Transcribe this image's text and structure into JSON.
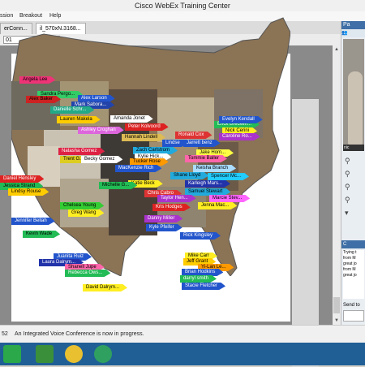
{
  "window": {
    "title": "Cisco WebEx Training Center"
  },
  "menu": [
    {
      "label": "ssion"
    },
    {
      "label": "Breakout"
    },
    {
      "label": "Help"
    }
  ],
  "tabs": [
    {
      "label": "erConn..."
    },
    {
      "label": "il_570xN.3168..."
    }
  ],
  "toolbar": {
    "page_value": "01"
  },
  "panel": {
    "header": "Pa",
    "video_name": "nic",
    "chat_header": "C",
    "chat_text": "Trying t from M great jo from M great jo",
    "send_to_label": "Send to"
  },
  "status": {
    "left_number": "52",
    "message": "An Integrated Voice Conference is now in progress."
  },
  "colors": {
    "taskbar": "#1f5f95",
    "panel_header": "#3f6fa6"
  },
  "labels": [
    {
      "text": "Angela Lee",
      "color": "#ee3377"
    },
    {
      "text": "Sandra Pergo...",
      "color": "#33cc66"
    },
    {
      "text": "Alex Baker",
      "color": "#cc2222"
    },
    {
      "text": "Alex Larson",
      "color": "#2255cc"
    },
    {
      "text": "Mark Sabora...",
      "color": "#2244aa"
    },
    {
      "text": "Danielle Schr...",
      "color": "#22aa88"
    },
    {
      "text": "Amanda Jonet",
      "color": "#ffffff"
    },
    {
      "text": "Lauren Makela",
      "color": "#ffcc00"
    },
    {
      "text": "Ashley Croghan",
      "color": "#dd66dd"
    },
    {
      "text": "Peter Kolvoord",
      "color": "#dd2222"
    },
    {
      "text": "Erick Brecken...",
      "color": "#22bb55"
    },
    {
      "text": "Evelyn Kendall",
      "color": "#2255cc"
    },
    {
      "text": "Nick Cerini",
      "color": "#ffee22"
    },
    {
      "text": "Ronald Cox",
      "color": "#dd3333"
    },
    {
      "text": "Hannah Lindell",
      "color": "#ddbb55"
    },
    {
      "text": "Caroline Ro...",
      "color": "#aa33cc"
    },
    {
      "text": "Lindse",
      "color": "#2255cc"
    },
    {
      "text": "Jarrett benz",
      "color": "#2255cc"
    },
    {
      "text": "Natasha Gomez",
      "color": "#dd2244"
    },
    {
      "text": "Zach Carlstrom",
      "color": "#22aadd"
    },
    {
      "text": "Trent G...",
      "color": "#ddcc22"
    },
    {
      "text": "Kylie Hick...",
      "color": "#ffffff"
    },
    {
      "text": "Jake Hom...",
      "color": "#ffff44"
    },
    {
      "text": "Becky Gomez",
      "color": "#ffffff"
    },
    {
      "text": "Tucker Rose",
      "color": "#ff9900"
    },
    {
      "text": "Tommie Baller",
      "color": "#ff66aa"
    },
    {
      "text": "MacKenzie Rich",
      "color": "#2255cc"
    },
    {
      "text": "Keisha Branch",
      "color": "#aaddff"
    },
    {
      "text": "Shane Lloyd",
      "color": "#22aadd"
    },
    {
      "text": "Spencer Mc...",
      "color": "#22ccff"
    },
    {
      "text": "Katie Beck",
      "color": "#ffee22"
    },
    {
      "text": "Karleigh Mars...",
      "color": "#2233aa"
    },
    {
      "text": "Michelle G...",
      "color": "#22bb55"
    },
    {
      "text": "Chris Cabro",
      "color": "#dd3333"
    },
    {
      "text": "Samuel Stewart",
      "color": "#22aadd"
    },
    {
      "text": "Taylor Hen...",
      "color": "#aa33cc"
    },
    {
      "text": "Marcie Stev...",
      "color": "#ff66ff"
    },
    {
      "text": "Kris Hodges",
      "color": "#dd2222"
    },
    {
      "text": "Jenna Mac...",
      "color": "#ffee22"
    },
    {
      "text": "Daniel Hensley",
      "color": "#dd2222"
    },
    {
      "text": "Jessica Strand",
      "color": "#22bb55"
    },
    {
      "text": "Lindsy Rouse",
      "color": "#ffcc00"
    },
    {
      "text": "Chelsea Young",
      "color": "#33cc33"
    },
    {
      "text": "Greg Wang",
      "color": "#ffee22"
    },
    {
      "text": "Jennifer Bellah",
      "color": "#2255cc"
    },
    {
      "text": "Danny Miller",
      "color": "#aa33cc"
    },
    {
      "text": "Kyle Pfeifer",
      "color": "#2255cc"
    },
    {
      "text": "Kevin Wade",
      "color": "#22bb55"
    },
    {
      "text": "Rick Kingsley",
      "color": "#2255cc"
    },
    {
      "text": "Mike Carr",
      "color": "#ffee22"
    },
    {
      "text": "Jeff Grant",
      "color": "#ffcc00"
    },
    {
      "text": "Yi-Lan Le...",
      "color": "#ff9900"
    },
    {
      "text": "Brian Hodkins",
      "color": "#2255cc"
    },
    {
      "text": "darryl smith",
      "color": "#22bb55"
    },
    {
      "text": "Stacie Fletcher",
      "color": "#2255cc"
    },
    {
      "text": "Juanita Ruiz",
      "color": "#2255cc"
    },
    {
      "text": "Laura Dalrym...",
      "color": "#2233aa"
    },
    {
      "text": "Shanell Jupe",
      "color": "#ff66aa"
    },
    {
      "text": "Rebecca Ows...",
      "color": "#22bb55"
    },
    {
      "text": "David Dalrym...",
      "color": "#ffee22"
    }
  ]
}
